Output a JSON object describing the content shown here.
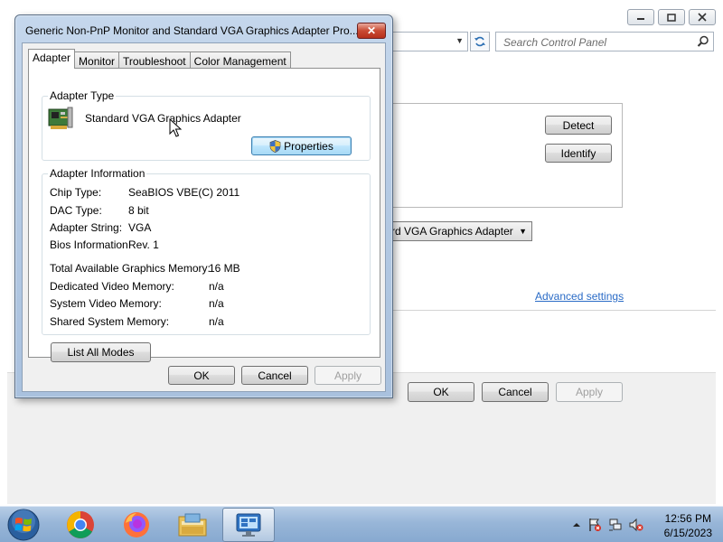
{
  "background_window": {
    "search_placeholder": "Search Control Panel",
    "buttons": {
      "detect": "Detect",
      "identify": "Identify",
      "ok": "OK",
      "cancel": "Cancel",
      "apply": "Apply"
    },
    "display_combo_value": "rd VGA Graphics Adapter",
    "advanced_settings_link": "Advanced settings"
  },
  "dialog": {
    "title": "Generic Non-PnP Monitor and Standard VGA Graphics Adapter Pro...",
    "close_glyph": "✕",
    "tabs": [
      "Adapter",
      "Monitor",
      "Troubleshoot",
      "Color Management"
    ],
    "active_tab": "Adapter",
    "adapter_type": {
      "legend": "Adapter Type",
      "name": "Standard VGA Graphics Adapter",
      "properties_button": "Properties"
    },
    "adapter_info": {
      "legend": "Adapter Information",
      "rows": [
        {
          "key": "Chip Type:",
          "value": "SeaBIOS VBE(C) 2011"
        },
        {
          "key": "DAC Type:",
          "value": "8 bit"
        },
        {
          "key": "Adapter String:",
          "value": "VGA"
        },
        {
          "key": "Bios Information:",
          "value": "Rev. 1"
        }
      ],
      "memory_rows": [
        {
          "key": "Total Available Graphics Memory:",
          "value": "16 MB"
        },
        {
          "key": "Dedicated Video Memory:",
          "value": "n/a"
        },
        {
          "key": "System Video Memory:",
          "value": "n/a"
        },
        {
          "key": "Shared System Memory:",
          "value": "n/a"
        }
      ]
    },
    "list_all_modes_button": "List All Modes",
    "buttons": {
      "ok": "OK",
      "cancel": "Cancel",
      "apply": "Apply"
    }
  },
  "taskbar": {
    "apps": [
      "start",
      "chrome",
      "firefox",
      "file-explorer",
      "control-panel"
    ],
    "active_app": "control-panel",
    "clock_time": "12:56 PM",
    "clock_date": "6/15/2023"
  },
  "colors": {
    "dialog_frame": "#b6cbe4",
    "close_button": "#c94a33",
    "link": "#2a6bc6",
    "taskbar": "#98b6d8"
  }
}
